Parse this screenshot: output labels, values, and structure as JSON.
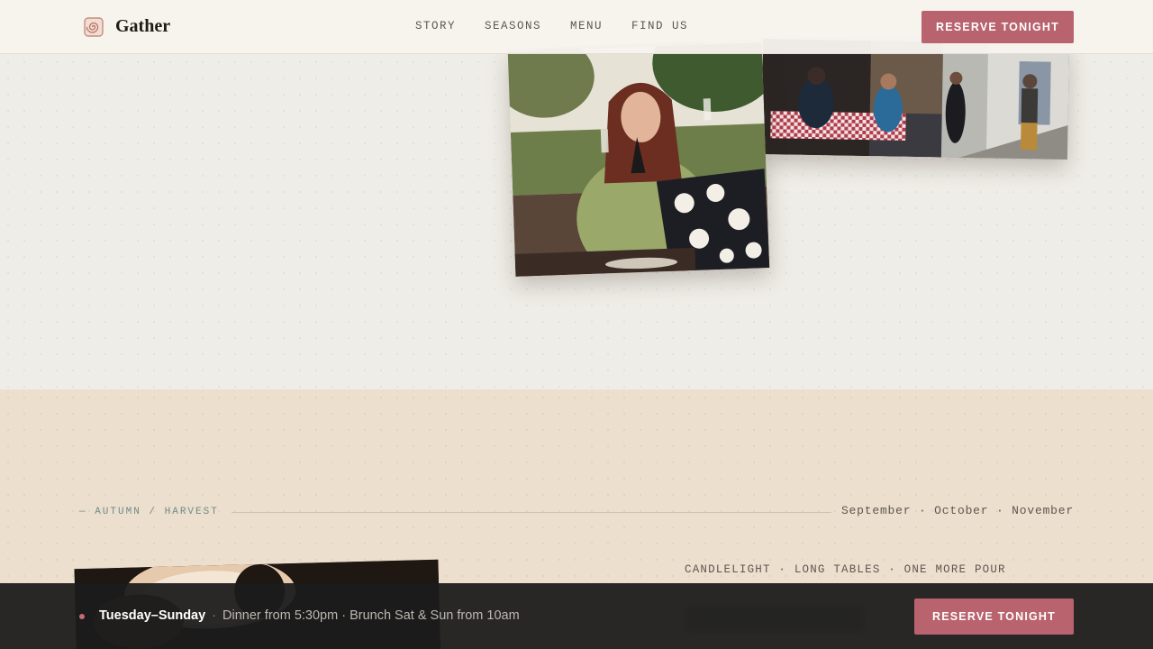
{
  "header": {
    "brand_name": "Gather",
    "brand_icon": "spiral-logo-icon",
    "nav": [
      {
        "label": "STORY"
      },
      {
        "label": "SEASONS"
      },
      {
        "label": "MENU"
      },
      {
        "label": "FIND US"
      }
    ],
    "reserve_label": "RESERVE TONIGHT"
  },
  "gallery": {
    "photos": [
      {
        "name": "woman-toasting-wine-outdoors-photo"
      },
      {
        "name": "street-cafe-diners-photo"
      }
    ]
  },
  "season": {
    "label": "— AUTUMN / HARVEST",
    "months": "September · October · November",
    "tagline": "CANDLELIGHT · LONG TABLES · ONE MORE POUR"
  },
  "bottom_bar": {
    "days": "Tuesday–Sunday",
    "separator": "·",
    "hours": "Dinner from 5:30pm · Brunch Sat & Sun from 10am",
    "reserve_label": "RESERVE TONIGHT"
  },
  "colors": {
    "accent": "#b9636e",
    "page_background": "#efede7",
    "autumn_background": "#eddfce",
    "bar_background": "#1c1c1c",
    "label_teal": "#6f8b86"
  }
}
